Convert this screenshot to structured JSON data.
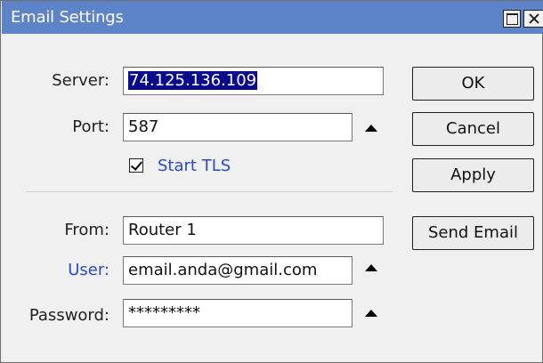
{
  "window": {
    "title": "Email Settings"
  },
  "form": {
    "server_label": "Server:",
    "server_value": "74.125.136.109",
    "port_label": "Port:",
    "port_value": "587",
    "start_tls_label": "Start TLS",
    "start_tls_checked": true,
    "from_label": "From:",
    "from_value": "Router 1",
    "user_label": "User:",
    "user_value": "email.anda@gmail.com",
    "password_label": "Password:",
    "password_value": "*********"
  },
  "buttons": {
    "ok": "OK",
    "cancel": "Cancel",
    "apply": "Apply",
    "send_email": "Send Email"
  },
  "colors": {
    "titlebar": "#5d83c9",
    "link_label": "#2a49c9",
    "selection": "#0a0a8c"
  }
}
